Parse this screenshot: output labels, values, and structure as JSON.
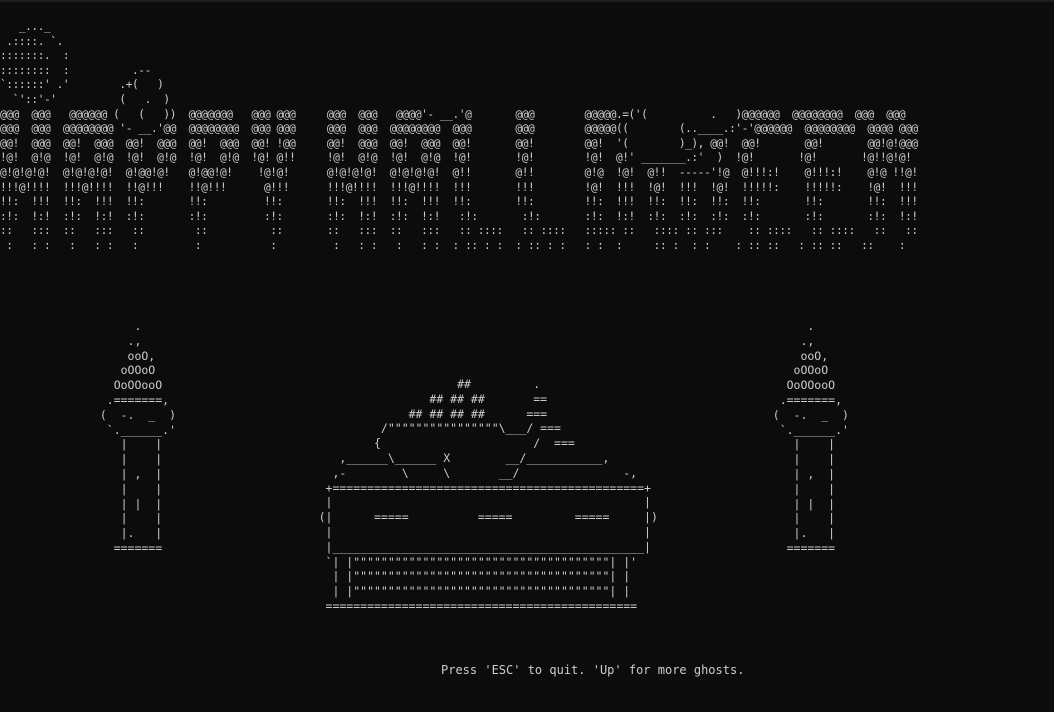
{
  "terminal": {
    "background": "#0c0c0c",
    "foreground": "#cccccc"
  },
  "banner_art": "   _..._\n .::::. `.\n:::::::.  :\n::::::::  :          .--\n`::::::' .'        .+(   )\n  `'::'-'          (   .  )\n@@@  @@@   @@@@@@ (   (   ))  @@@@@@@   @@@ @@@     @@@  @@@   @@@@'- __.'@       @@@        @@@@@.=('(          .   )@@@@@@  @@@@@@@@  @@@  @@@\n@@@  @@@  @@@@@@@@ '- __.'@@  @@@@@@@@  @@@ @@@     @@@  @@@  @@@@@@@@  @@@       @@@        @@@@@((        (..____.:'-'@@@@@@  @@@@@@@@  @@@@ @@@\n@@!  @@@  @@!  @@@  @@!  @@@  @@!  @@@  @@! !@@     @@!  @@@  @@!  @@@  @@!       @@!        @@!  '(        )_), @@!  @@!       @@!       @@!@!@@@\n!@!  @!@  !@!  @!@  !@!  @!@  !@!  @!@  !@! @!!     !@!  @!@  !@!  @!@  !@!       !@!        !@!  @!' _______.:'  )  !@!       !@!       !@!!@!@!\n@!@!@!@!  @!@!@!@!  @!@@!@!   @!@@!@!    !@!@!      @!@!@!@!  @!@!@!@!  @!!       @!!        @!@  !@!  @!!  -----'!@  @!!!:!    @!!!:!    @!@ !!@!\n!!!@!!!!  !!!@!!!!  !!@!!!    !!@!!!      @!!!      !!!@!!!!  !!!@!!!!  !!!       !!!        !@!  !!!  !@!  !!!  !@!  !!!!!:    !!!!!:    !@!  !!!\n!!:  !!!  !!:  !!!  !!:       !!:         !!:       !!:  !!!  !!:  !!!  !!:       !!:        !!:  !!!  !!:  !!:  !!:  !!:       !!:       !!:  !!!\n:!:  !:!  :!:  !:!  :!:       :!:         :!:       :!:  !:!  :!:  !:!   :!:       :!:       :!:  !:!  :!:  :!:  :!:  :!:       :!:       :!:  !:!\n::   :::  ::   :::   ::        ::          ::       ::   :::  ::   :::   :: ::::   :: ::::   ::::: ::   :::: :: :::    :: ::::   :: ::::   ::   ::\n :   : :   :   : :   :         :           :         :   : :   :   : :  : :: : :  : :: : :   : :  :     :: :  : :    : :: ::   : :: ::   ::    :",
  "candle_left_art": "       .\n      .,\n      ooO,\n     oOOoO\n    OoOOooO\n   .=======,\n  (  -.  _  )\n   `.______.'\n     |    |\n     |    |\n     | ,  |\n     |    |\n     | |  |\n     |    |\n     |.   |\n    =======",
  "candle_right_art": "        .\n       .,\n       ooO,\n      oOOoO\n     OoOOooO\n    .=======,\n   (  -.  _  )\n    `.______.'\n      |    |\n      |    |\n      | ,  |\n      |    |\n      | |  |\n      |    |\n      |.   |\n     =======",
  "coffin_art": "                         ##         .\n                     ## ## ##       ==\n                  ## ## ## ##      ===\n              /\"\"\"\"\"\"\"\"\"\"\"\"\"\"\"\"\\___/ ===\n             {                      /  ===\n        ,______\\______ X        __/___________,\n       ,-        \\     \\       __/               -,\n      +=============================================+\n      |                                             |\n     (|      =====          =====         =====     |)\n      |                                             |\n      |_____________________________________________|\n      `| |\"\"\"\"\"\"\"\"\"\"\"\"\"\"\"\"\"\"\"\"\"\"\"\"\"\"\"\"\"\"\"\"\"\"\"\"\"| |'\n       | |\"\"\"\"\"\"\"\"\"\"\"\"\"\"\"\"\"\"\"\"\"\"\"\"\"\"\"\"\"\"\"\"\"\"\"\"\"| |\n       | |\"\"\"\"\"\"\"\"\"\"\"\"\"\"\"\"\"\"\"\"\"\"\"\"\"\"\"\"\"\"\"\"\"\"\"\"\"| |\n      =============================================",
  "status": {
    "message": "Press 'ESC' to quit. 'Up' for more ghosts."
  }
}
